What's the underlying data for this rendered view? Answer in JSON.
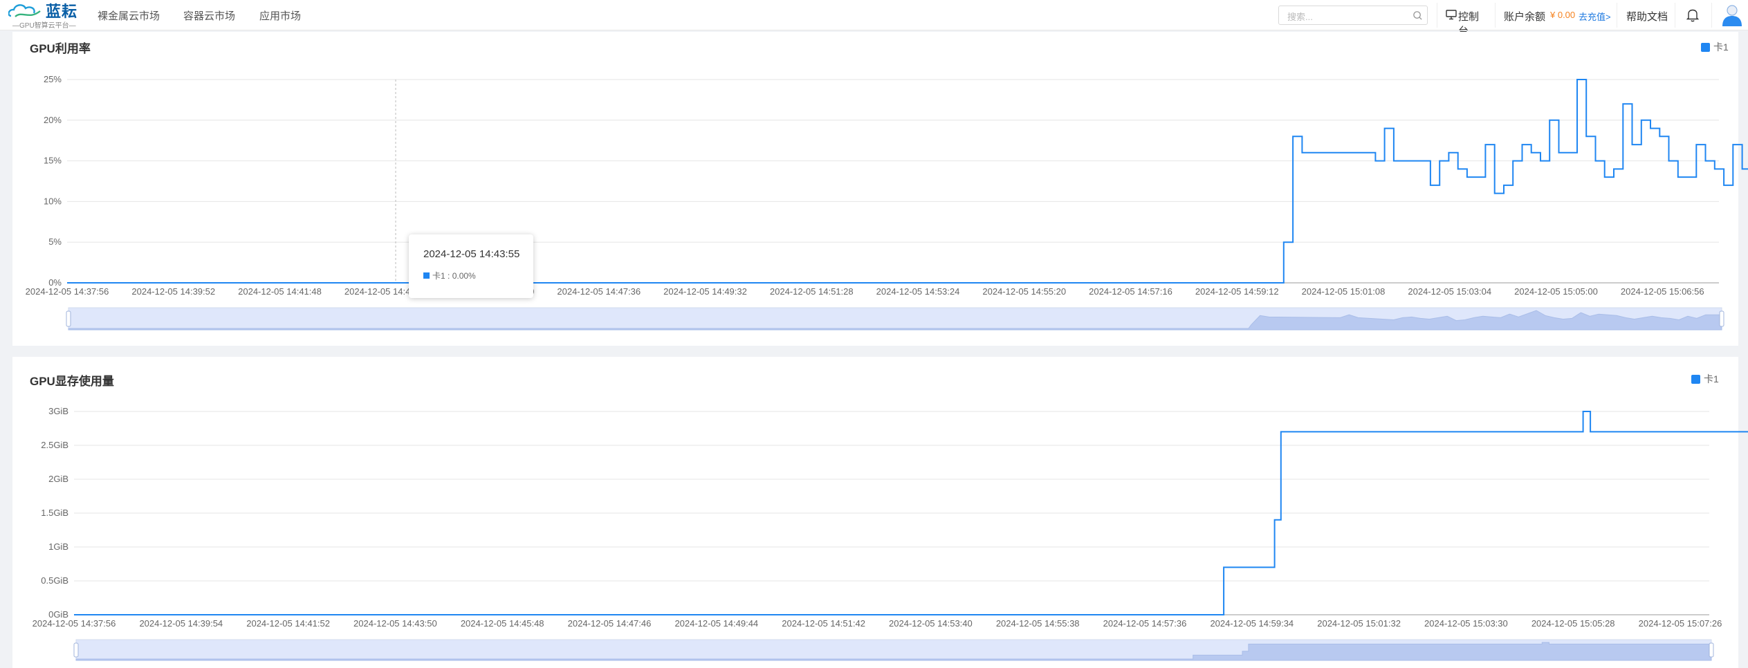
{
  "header": {
    "logo_text": "蓝耘",
    "logo_sub": "—GPU智算云平台—",
    "nav": [
      {
        "label": "裸金属云市场"
      },
      {
        "label": "容器云市场"
      },
      {
        "label": "应用市场"
      }
    ],
    "search_placeholder": "搜索...",
    "console_label": "控制台",
    "balance_label": "账户余额",
    "balance_value": "¥ 0.00",
    "recharge_label": "去充值>",
    "help_label": "帮助文档"
  },
  "colors": {
    "series": "#1f86f2",
    "balance": "#f5821f",
    "link": "#1f7ae0",
    "zoom_fill": "#dfe7fb"
  },
  "tooltip": {
    "time": "2024-12-05 14:43:55",
    "series_name": "卡1",
    "value": "0.00%"
  },
  "chart_data": [
    {
      "type": "line",
      "step": true,
      "title": "GPU利用率",
      "legend_position": "top-right",
      "grid": true,
      "ylim": [
        0,
        25
      ],
      "y_ticks": [
        "0%",
        "5%",
        "10%",
        "15%",
        "20%",
        "25%"
      ],
      "x_ticks": [
        "2024-12-05 14:37:56",
        "2024-12-05 14:39:52",
        "2024-12-05 14:41:48",
        "2024-12-05 14:43:44",
        "2024-12-05 14:45:40",
        "2024-12-05 14:47:36",
        "2024-12-05 14:49:32",
        "2024-12-05 14:51:28",
        "2024-12-05 14:53:24",
        "2024-12-05 14:55:20",
        "2024-12-05 14:57:16",
        "2024-12-05 14:59:12",
        "2024-12-05 15:01:08",
        "2024-12-05 15:03:04",
        "2024-12-05 15:05:00",
        "2024-12-05 15:06:56"
      ],
      "series": [
        {
          "name": "卡1",
          "points": [
            [
              "2024-12-05 14:37:56",
              0
            ],
            [
              "2024-12-05 15:00:00",
              0
            ],
            [
              "2024-12-05 15:00:03",
              5
            ],
            [
              "2024-12-05 15:00:13",
              18
            ],
            [
              "2024-12-05 15:00:23",
              16
            ],
            [
              "2024-12-05 15:01:43",
              15
            ],
            [
              "2024-12-05 15:01:53",
              19
            ],
            [
              "2024-12-05 15:02:03",
              15
            ],
            [
              "2024-12-05 15:02:43",
              12
            ],
            [
              "2024-12-05 15:02:53",
              15
            ],
            [
              "2024-12-05 15:03:03",
              16
            ],
            [
              "2024-12-05 15:03:13",
              14
            ],
            [
              "2024-12-05 15:03:23",
              13
            ],
            [
              "2024-12-05 15:03:43",
              17
            ],
            [
              "2024-12-05 15:03:53",
              11
            ],
            [
              "2024-12-05 15:04:03",
              12
            ],
            [
              "2024-12-05 15:04:13",
              15
            ],
            [
              "2024-12-05 15:04:23",
              17
            ],
            [
              "2024-12-05 15:04:33",
              16
            ],
            [
              "2024-12-05 15:04:43",
              15
            ],
            [
              "2024-12-05 15:04:53",
              20
            ],
            [
              "2024-12-05 15:05:03",
              16
            ],
            [
              "2024-12-05 15:05:23",
              25
            ],
            [
              "2024-12-05 15:05:33",
              18
            ],
            [
              "2024-12-05 15:05:43",
              15
            ],
            [
              "2024-12-05 15:05:53",
              13
            ],
            [
              "2024-12-05 15:06:03",
              14
            ],
            [
              "2024-12-05 15:06:13",
              22
            ],
            [
              "2024-12-05 15:06:23",
              17
            ],
            [
              "2024-12-05 15:06:33",
              20
            ],
            [
              "2024-12-05 15:06:43",
              19
            ],
            [
              "2024-12-05 15:06:53",
              18
            ],
            [
              "2024-12-05 15:07:03",
              15
            ],
            [
              "2024-12-05 15:07:13",
              13
            ],
            [
              "2024-12-05 15:07:33",
              17
            ],
            [
              "2024-12-05 15:07:43",
              15
            ],
            [
              "2024-12-05 15:07:53",
              14
            ],
            [
              "2024-12-05 15:08:03",
              12
            ],
            [
              "2024-12-05 15:08:13",
              17
            ],
            [
              "2024-12-05 15:08:23",
              14
            ],
            [
              "2024-12-05 15:08:33",
              19
            ],
            [
              "2024-12-05 15:08:51",
              19
            ]
          ]
        }
      ]
    },
    {
      "type": "line",
      "step": true,
      "title": "GPU显存使用量",
      "legend_position": "top-right",
      "grid": true,
      "ylim": [
        0,
        3
      ],
      "y_ticks": [
        "0GiB",
        "0.5GiB",
        "1GiB",
        "1.5GiB",
        "2GiB",
        "2.5GiB",
        "3GiB"
      ],
      "x_ticks": [
        "2024-12-05 14:37:56",
        "2024-12-05 14:39:54",
        "2024-12-05 14:41:52",
        "2024-12-05 14:43:50",
        "2024-12-05 14:45:48",
        "2024-12-05 14:47:46",
        "2024-12-05 14:49:44",
        "2024-12-05 14:51:42",
        "2024-12-05 14:53:40",
        "2024-12-05 14:55:38",
        "2024-12-05 14:57:36",
        "2024-12-05 14:59:34",
        "2024-12-05 15:01:32",
        "2024-12-05 15:03:30",
        "2024-12-05 15:05:28",
        "2024-12-05 15:07:26"
      ],
      "series": [
        {
          "name": "卡1",
          "points": [
            [
              "2024-12-05 14:37:56",
              0
            ],
            [
              "2024-12-05 14:59:03",
              0
            ],
            [
              "2024-12-05 14:59:03",
              0.7
            ],
            [
              "2024-12-05 14:59:59",
              0.7
            ],
            [
              "2024-12-05 14:59:59",
              1.4
            ],
            [
              "2024-12-05 15:00:06",
              1.4
            ],
            [
              "2024-12-05 15:00:06",
              2.7
            ],
            [
              "2024-12-05 15:05:39",
              2.7
            ],
            [
              "2024-12-05 15:05:39",
              3.0
            ],
            [
              "2024-12-05 15:05:47",
              3.0
            ],
            [
              "2024-12-05 15:05:47",
              2.7
            ],
            [
              "2024-12-05 15:08:51",
              2.7
            ]
          ]
        }
      ]
    }
  ]
}
